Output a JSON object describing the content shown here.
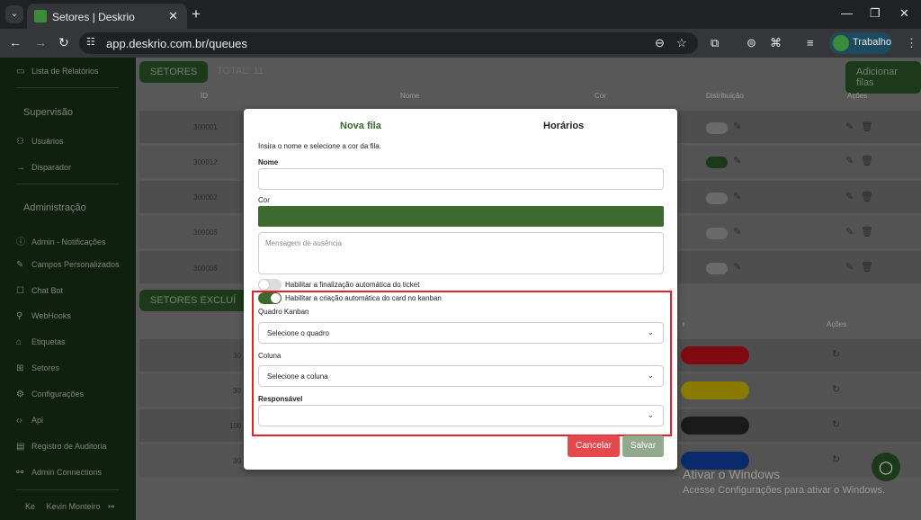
{
  "browser": {
    "tab_title": "Setores | Deskrio",
    "url": "app.deskrio.com.br/queues",
    "profile_label": "Trabalho",
    "tab_close": "✕",
    "new_tab": "+",
    "win_min": "—",
    "win_max": "❐",
    "win_close": "✕"
  },
  "sidebar": {
    "top_item": "Lista de Relatórios",
    "section_supervisao": "Supervisão",
    "supervisao_items": [
      "Usuários",
      "Disparador"
    ],
    "section_administracao": "Administração",
    "admin_items": [
      "Admin - Notificações",
      "Campos Personalizados",
      "Chat Bot",
      "WebHooks",
      "Etiquetas",
      "Setores",
      "Configurações",
      "Api",
      "Registro de Auditoria",
      "Admin Connections"
    ],
    "user_initials": "Ke",
    "user_name": "Kevin Monteiro"
  },
  "background": {
    "chip_setores": "SETORES",
    "chip_total": "TOTAL: 11",
    "add_button": "Adicionar filas",
    "headers": {
      "id": "ID",
      "nome": "Nome",
      "cor": "Cor",
      "distribuicao": "Distribuição",
      "acoes": "Ações"
    },
    "rows": [
      {
        "id": "300001",
        "dist_on": false
      },
      {
        "id": "300012",
        "dist_on": true
      },
      {
        "id": "300002",
        "dist_on": false
      },
      {
        "id": "300005",
        "dist_on": false
      },
      {
        "id": "300006",
        "dist_on": false
      }
    ],
    "excluded_chip": "SETORES EXCLUÍ",
    "excluded_headers": {
      "cor": "r",
      "acoes": "Ações"
    },
    "excluded_rows": [
      {
        "id": "30",
        "pill_color": "#7f0a10"
      },
      {
        "id": "30",
        "pill_color": "#8a7a00"
      },
      {
        "id": "100",
        "pill_color": "#1a1a1a"
      },
      {
        "id": "30",
        "pill_color": "#0b2a6a"
      }
    ],
    "windows_title": "Ativar o Windows",
    "windows_sub": "Acesse Configurações para ativar o Windows."
  },
  "modal": {
    "tab_nova_fila": "Nova fila",
    "tab_horarios": "Horários",
    "description": "Insira o nome e selecione a cor da fila.",
    "nome_label": "Nome",
    "nome_value": "",
    "cor_label": "Cor",
    "cor_value": "#3c6b2d",
    "mensagem_placeholder": "Mensagem de ausência",
    "toggle_finalizacao_label": "Habilitar a finalização automática do ticket",
    "toggle_finalizacao_on": false,
    "toggle_kanban_label": "Habilitar a criação automática do card no kanban",
    "toggle_kanban_on": true,
    "quadro_label": "Quadro Kanban",
    "quadro_value": "Selecione o quadro",
    "coluna_label": "Coluna",
    "coluna_value": "Selecione a coluna",
    "responsavel_label": "Responsável",
    "responsavel_value": "",
    "cancel_label": "Cancelar",
    "save_label": "Salvar"
  },
  "colors": {
    "accent": "#3a6b2c",
    "danger": "#e5484d",
    "highlight_border": "#e0202a"
  }
}
